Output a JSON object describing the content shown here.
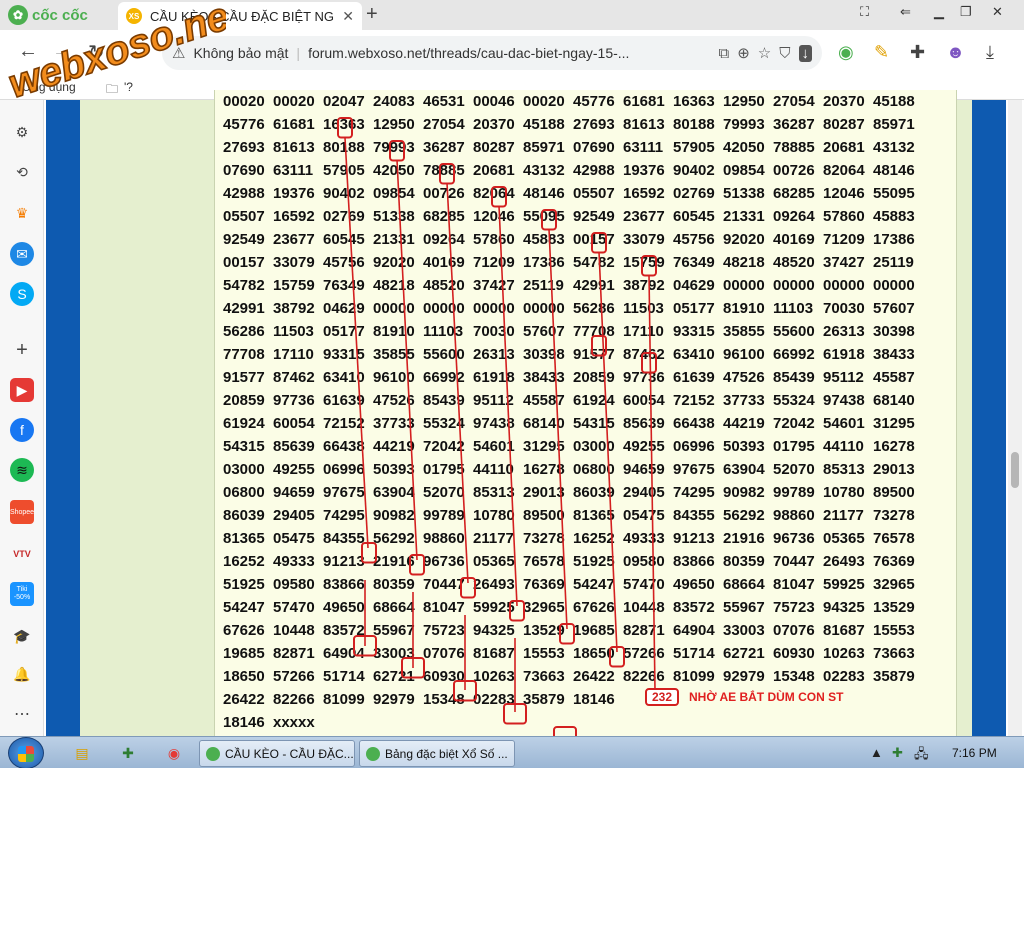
{
  "browser": {
    "brand": "cốc cốc",
    "tab_title": "CẦU KÈO - CẦU ĐẶC BIỆT NG",
    "tab_favicon_text": "XS",
    "new_tab_label": "+",
    "security_label": "Không bảo mật",
    "url": "forum.webxoso.net/threads/cau-dac-biet-ngay-15-...",
    "bookmarks": [
      "Ứng dụng",
      "'?"
    ]
  },
  "watermark": "webxoso.net",
  "sidebar_icons": [
    "gear-icon",
    "history-icon",
    "crown-icon",
    "messenger-icon",
    "skype-icon",
    "add-icon",
    "youtube-icon",
    "facebook-icon",
    "spotify-icon",
    "shopee-icon",
    "vtv-icon",
    "tiki-icon",
    "graduation-icon",
    "bell-icon",
    "more-icon"
  ],
  "sidebar_labels": {
    "shopee": "Shopee",
    "tiki": "Tiki -50%",
    "vtv": "VTV"
  },
  "post": {
    "rows": [
      [
        "00020",
        "00020",
        "02047",
        "24083",
        "46531",
        "00046",
        "00020",
        "45776",
        "61681",
        "16363",
        "12950",
        "27054",
        "20370",
        "45188"
      ],
      [
        "45776",
        "61681",
        "16363",
        "12950",
        "27054",
        "20370",
        "45188",
        "27693",
        "81613",
        "80188",
        "79993",
        "36287",
        "80287",
        "85971"
      ],
      [
        "27693",
        "81613",
        "80188",
        "79993",
        "36287",
        "80287",
        "85971",
        "07690",
        "63111",
        "57905",
        "42050",
        "78885",
        "20681",
        "43132"
      ],
      [
        "07690",
        "63111",
        "57905",
        "42050",
        "78885",
        "20681",
        "43132",
        "42988",
        "19376",
        "90402",
        "09854",
        "00726",
        "82064",
        "48146"
      ],
      [
        "42988",
        "19376",
        "90402",
        "09854",
        "00726",
        "82064",
        "48146",
        "05507",
        "16592",
        "02769",
        "51338",
        "68285",
        "12046",
        "55095"
      ],
      [
        "05507",
        "16592",
        "02769",
        "51338",
        "68285",
        "12046",
        "55095",
        "92549",
        "23677",
        "60545",
        "21331",
        "09264",
        "57860",
        "45883"
      ],
      [
        "92549",
        "23677",
        "60545",
        "21331",
        "09264",
        "57860",
        "45883",
        "00157",
        "33079",
        "45756",
        "92020",
        "40169",
        "71209",
        "17386"
      ],
      [
        "00157",
        "33079",
        "45756",
        "92020",
        "40169",
        "71209",
        "17386",
        "54782",
        "15759",
        "76349",
        "48218",
        "48520",
        "37427",
        "25119"
      ],
      [
        "54782",
        "15759",
        "76349",
        "48218",
        "48520",
        "37427",
        "25119",
        "42991",
        "38792",
        "04629",
        "00000",
        "00000",
        "00000",
        "00000"
      ],
      [
        "42991",
        "38792",
        "04629",
        "00000",
        "00000",
        "00000",
        "00000",
        "56286",
        "11503",
        "05177",
        "81910",
        "11103",
        "70030",
        "57607"
      ],
      [
        "56286",
        "11503",
        "05177",
        "81910",
        "11103",
        "70030",
        "57607",
        "77708",
        "17110",
        "93315",
        "35855",
        "55600",
        "26313",
        "30398"
      ],
      [
        "77708",
        "17110",
        "93315",
        "35855",
        "55600",
        "26313",
        "30398",
        "91577",
        "87462",
        "63410",
        "96100",
        "66992",
        "61918",
        "38433"
      ],
      [
        "91577",
        "87462",
        "63410",
        "96100",
        "66992",
        "61918",
        "38433",
        "20859",
        "97736",
        "61639",
        "47526",
        "85439",
        "95112",
        "45587"
      ],
      [
        "20859",
        "97736",
        "61639",
        "47526",
        "85439",
        "95112",
        "45587",
        "61924",
        "60054",
        "72152",
        "37733",
        "55324",
        "97438",
        "68140"
      ],
      [
        "61924",
        "60054",
        "72152",
        "37733",
        "55324",
        "97438",
        "68140",
        "54315",
        "85639",
        "66438",
        "44219",
        "72042",
        "54601",
        "31295"
      ],
      [
        "54315",
        "85639",
        "66438",
        "44219",
        "72042",
        "54601",
        "31295",
        "03000",
        "49255",
        "06996",
        "50393",
        "01795",
        "44110",
        "16278"
      ],
      [
        "03000",
        "49255",
        "06996",
        "50393",
        "01795",
        "44110",
        "16278",
        "06800",
        "94659",
        "97675",
        "63904",
        "52070",
        "85313",
        "29013"
      ],
      [
        "06800",
        "94659",
        "97675",
        "63904",
        "52070",
        "85313",
        "29013",
        "86039",
        "29405",
        "74295",
        "90982",
        "99789",
        "10780",
        "89500"
      ],
      [
        "86039",
        "29405",
        "74295",
        "90982",
        "99789",
        "10780",
        "89500",
        "81365",
        "05475",
        "84355",
        "56292",
        "98860",
        "21177",
        "73278"
      ],
      [
        "81365",
        "05475",
        "84355",
        "56292",
        "98860",
        "21177",
        "73278",
        "16252",
        "49333",
        "91213",
        "21916",
        "96736",
        "05365",
        "76578"
      ],
      [
        "16252",
        "49333",
        "91213",
        "21916",
        "96736",
        "05365",
        "76578",
        "51925",
        "09580",
        "83866",
        "80359",
        "70447",
        "26493",
        "76369"
      ],
      [
        "51925",
        "09580",
        "83866",
        "80359",
        "70447",
        "26493",
        "76369",
        "54247",
        "57470",
        "49650",
        "68664",
        "81047",
        "59925",
        "32965"
      ],
      [
        "54247",
        "57470",
        "49650",
        "68664",
        "81047",
        "59925",
        "32965",
        "67626",
        "10448",
        "83572",
        "55967",
        "75723",
        "94325",
        "13529"
      ],
      [
        "67626",
        "10448",
        "83572",
        "55967",
        "75723",
        "94325",
        "13529",
        "19685",
        "82871",
        "64904",
        "33003",
        "07076",
        "81687",
        "15553"
      ],
      [
        "19685",
        "82871",
        "64904",
        "33003",
        "07076",
        "81687",
        "15553",
        "18650",
        "57266",
        "51714",
        "62721",
        "60930",
        "10263",
        "73663"
      ],
      [
        "18650",
        "57266",
        "51714",
        "62721",
        "60930",
        "10263",
        "73663",
        "26422",
        "82266",
        "81099",
        "92979",
        "15348",
        "02283",
        "35879"
      ],
      [
        "26422",
        "82266",
        "81099",
        "92979",
        "15348",
        "02283",
        "35879",
        "18146"
      ],
      [
        "18146",
        "xxxxx"
      ]
    ],
    "badge": "232",
    "note": "NHỜ AE BẮT DÙM CON ST"
  },
  "taskbar": {
    "tasks": [
      "CẦU KÈO - CẦU ĐẶC...",
      "Bảng đặc biệt Xổ Số ..."
    ],
    "clock": "7:16 PM"
  },
  "colors": {
    "band_blue": "#0e5ab0",
    "forum_green": "#e5efcf",
    "post_bg": "#fbfde6",
    "mark_red": "#d32020"
  }
}
